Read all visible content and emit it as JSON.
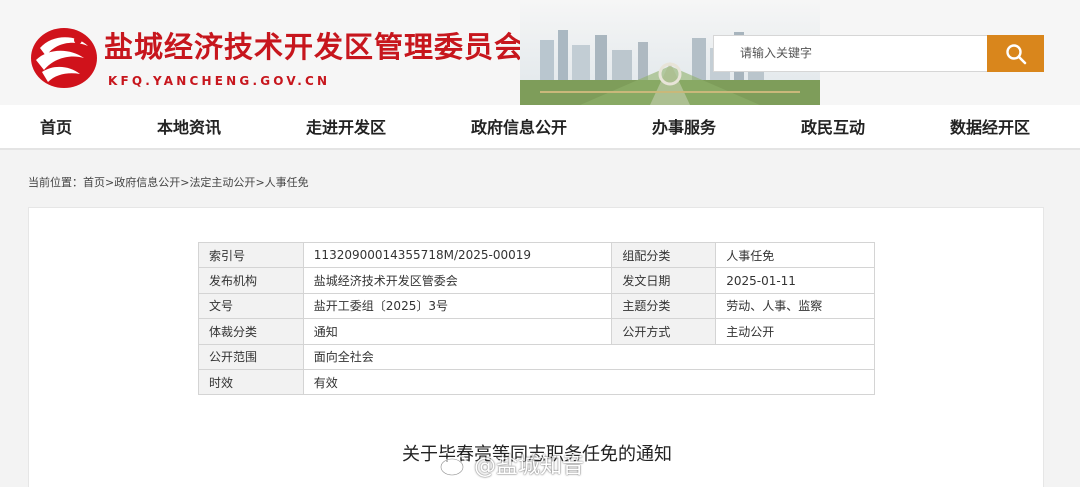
{
  "header": {
    "site_title": "盐城经济技术开发区管理委员会",
    "site_domain": "KFQ.YANCHENG.GOV.CN",
    "logo_icon": "flame-bird-logo",
    "brand_red": "#c7161d"
  },
  "search": {
    "placeholder": "请输入关键字",
    "button_icon": "search-icon",
    "button_color": "#d9861c"
  },
  "nav": {
    "items": [
      "首页",
      "本地资讯",
      "走进开发区",
      "政府信息公开",
      "办事服务",
      "政民互动",
      "数据经开区"
    ]
  },
  "breadcrumb": {
    "prefix": "当前位置：",
    "items": [
      "首页",
      "政府信息公开",
      "法定主动公开",
      "人事任免"
    ],
    "separator": ">"
  },
  "meta": {
    "rows": [
      {
        "label": "索引号",
        "value": "11320900014355718M/2025-00019",
        "label2": "组配分类",
        "value2": "人事任免"
      },
      {
        "label": "发布机构",
        "value": "盐城经济技术开发区管委会",
        "label2": "发文日期",
        "value2": "2025-01-11"
      },
      {
        "label": "文号",
        "value": "盐开工委组〔2025〕3号",
        "label2": "主题分类",
        "value2": "劳动、人事、监察"
      },
      {
        "label": "体裁分类",
        "value": "通知",
        "label2": "公开方式",
        "value2": "主动公开"
      },
      {
        "label": "公开范围",
        "value": "面向全社会"
      },
      {
        "label": "时效",
        "value": "有效"
      }
    ]
  },
  "document": {
    "title": "关于毕春亮等同志职务任免的通知"
  },
  "watermark": {
    "text": "@盐城知音",
    "icon": "weibo-icon"
  }
}
